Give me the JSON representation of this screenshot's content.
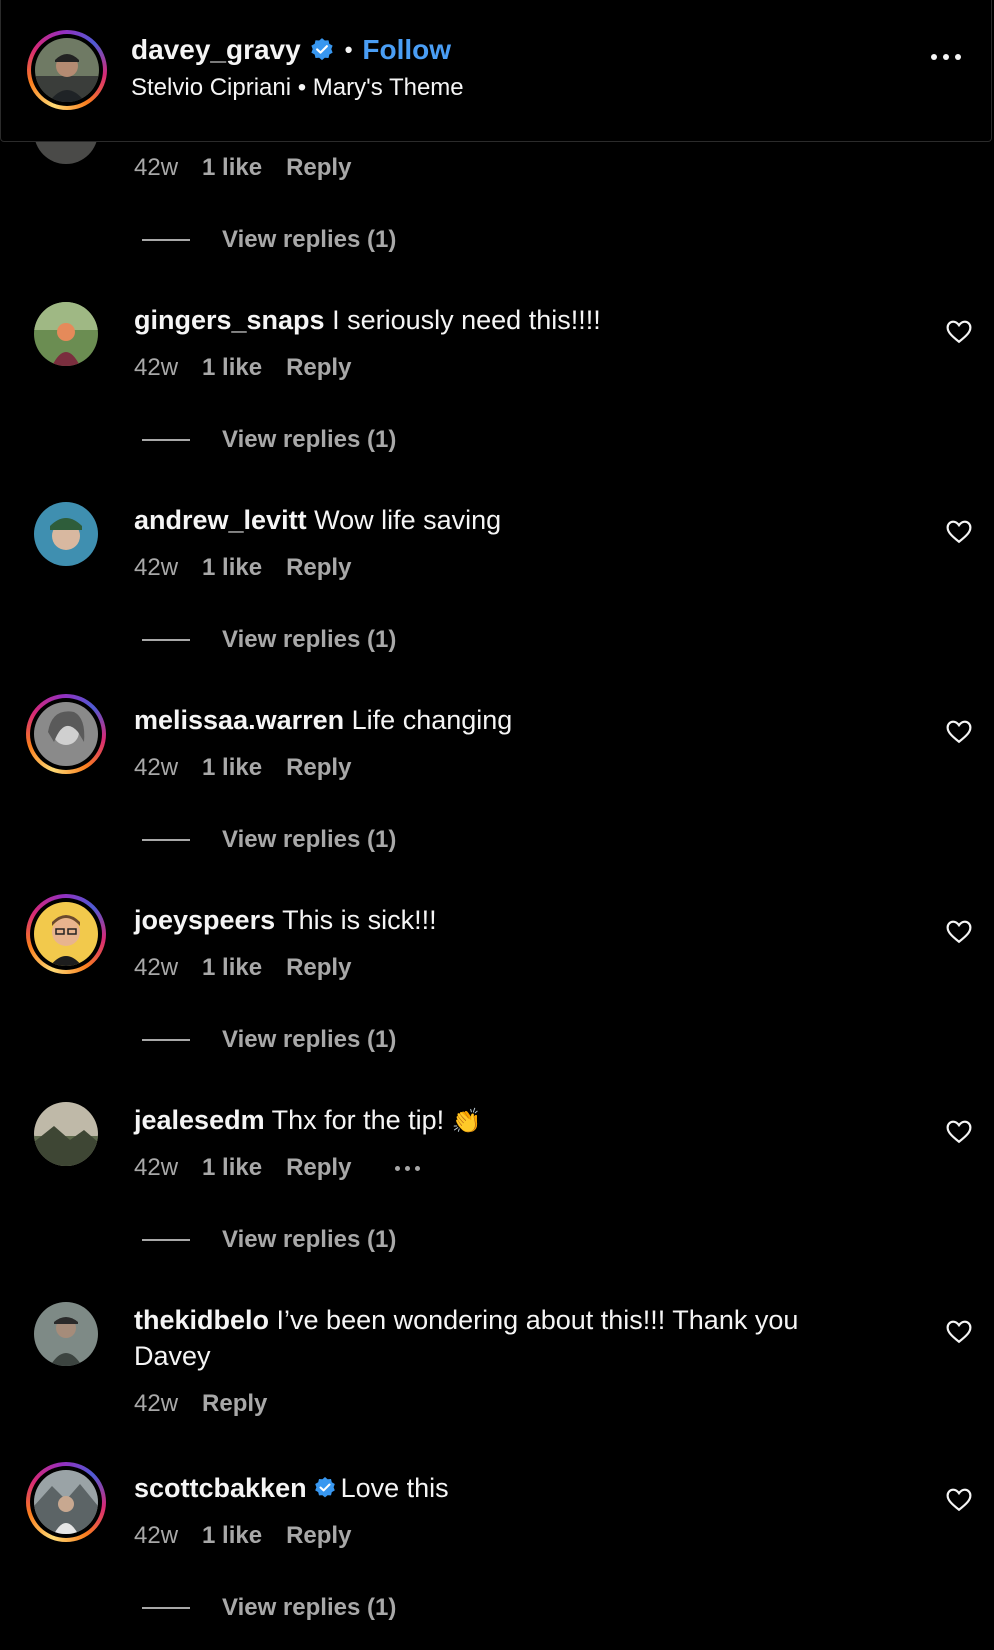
{
  "header": {
    "username": "davey_gravy",
    "verified": true,
    "separator": "•",
    "follow_label": "Follow",
    "subtitle": "Stelvio Cipriani • Mary's Theme",
    "more_icon": "more-horizontal-icon"
  },
  "top_partial": {
    "time": "42w",
    "likes": "1 like",
    "reply": "Reply",
    "view_replies": "View replies (1)"
  },
  "comments": [
    {
      "username": "gingers_snaps",
      "text": "I seriously need this!!!!",
      "time": "42w",
      "likes": "1 like",
      "reply": "Reply",
      "view_replies": "View replies (1)"
    },
    {
      "username": "andrew_levitt",
      "text": "Wow life saving",
      "time": "42w",
      "likes": "1 like",
      "reply": "Reply",
      "view_replies": "View replies (1)"
    },
    {
      "username": "melissaa.warren",
      "text": "Life changing",
      "time": "42w",
      "likes": "1 like",
      "reply": "Reply",
      "view_replies": "View replies (1)"
    },
    {
      "username": "joeyspeers",
      "text": "This is sick!!!",
      "time": "42w",
      "likes": "1 like",
      "reply": "Reply",
      "view_replies": "View replies (1)"
    },
    {
      "username": "jealesedm",
      "text": "Thx for the tip!",
      "emoji": "👏",
      "time": "42w",
      "likes": "1 like",
      "reply": "Reply",
      "view_replies": "View replies (1)"
    },
    {
      "username": "thekidbelo",
      "text": "I’ve been wondering about this!!! Thank you Davey",
      "time": "42w",
      "reply": "Reply"
    },
    {
      "username": "scottcbakken",
      "text": "Love this",
      "time": "42w",
      "likes": "1 like",
      "reply": "Reply",
      "view_replies": "View replies (1)"
    }
  ],
  "colors": {
    "background": "#000000",
    "text": "#f5f5f5",
    "muted": "#a8a8a8",
    "link": "#4a9ef5",
    "verified": "#3897f0"
  }
}
